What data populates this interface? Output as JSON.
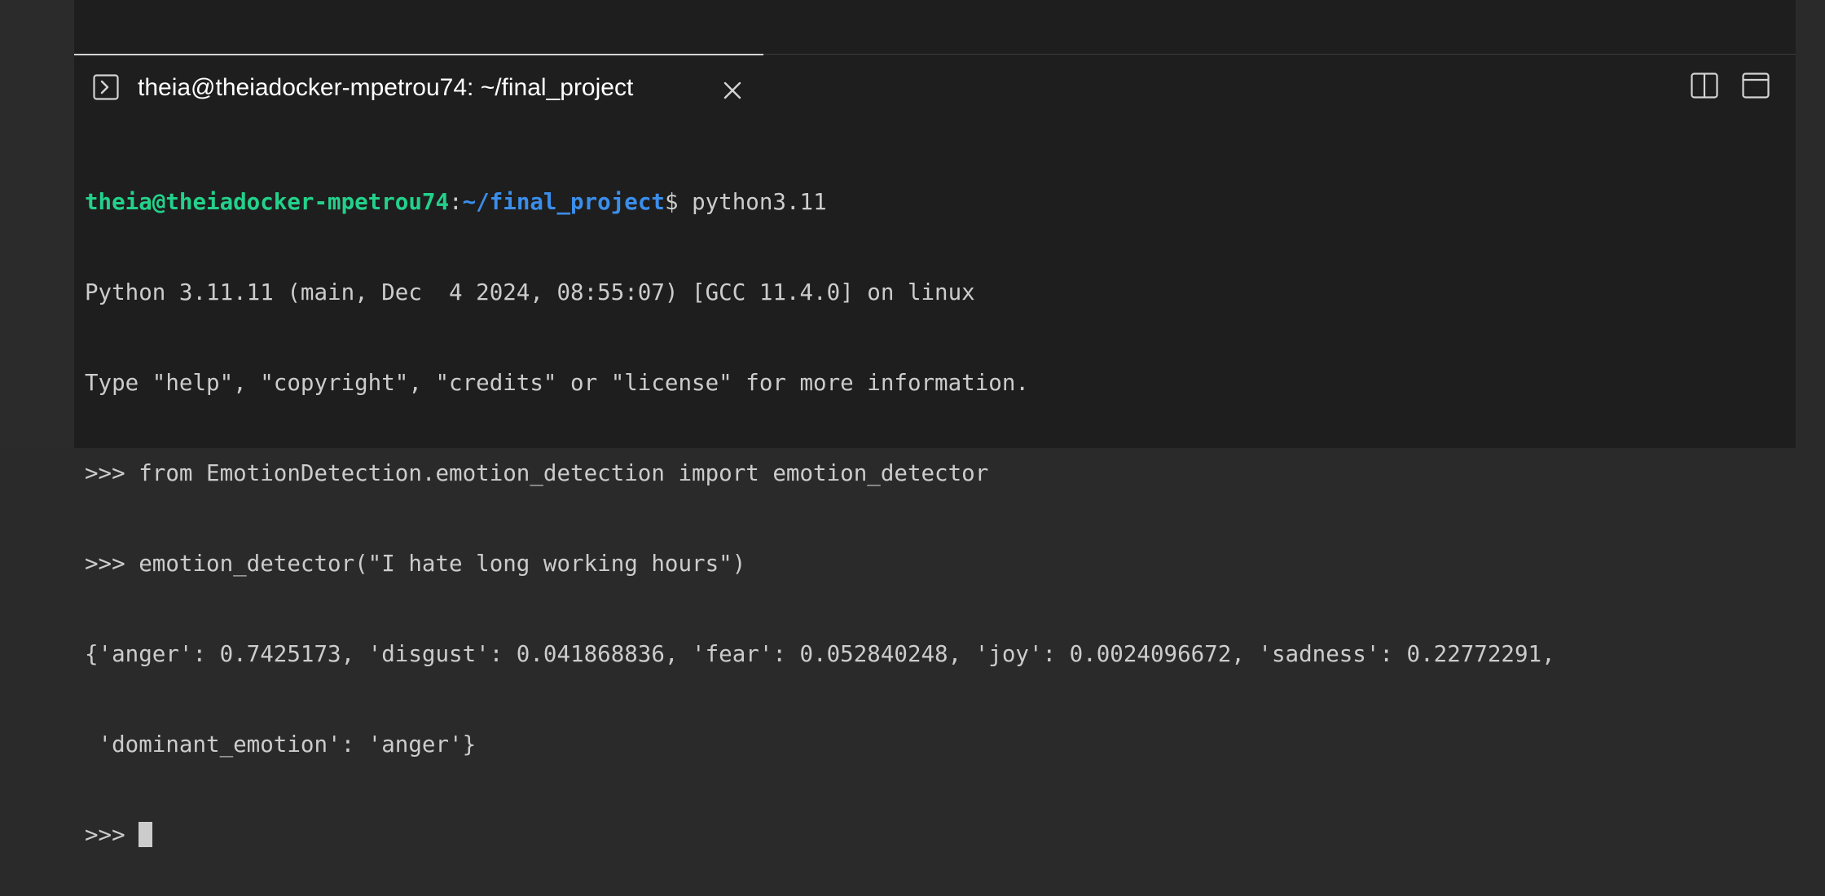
{
  "terminal_tab": {
    "title": "theia@theiadocker-mpetrou74: ~/final_project",
    "icon": "terminal-icon",
    "close_icon": "close-icon"
  },
  "toolbar": {
    "split_icon": "split-terminal-icon",
    "maximize_icon": "maximize-panel-icon"
  },
  "colors": {
    "prompt_user": "#23d18b",
    "prompt_path": "#3b8eea",
    "text": "#cccccc",
    "background": "#1e1e1e"
  },
  "terminal": {
    "prompt_user": "theia@theiadocker-mpetrou74",
    "prompt_sep": ":",
    "prompt_path": "~/final_project",
    "prompt_dollar": "$",
    "command": " python3.11",
    "lines": [
      "Python 3.11.11 (main, Dec  4 2024, 08:55:07) [GCC 11.4.0] on linux",
      "Type \"help\", \"copyright\", \"credits\" or \"license\" for more information.",
      ">>> from EmotionDetection.emotion_detection import emotion_detector",
      ">>> emotion_detector(\"I hate long working hours\")",
      "{'anger': 0.7425173, 'disgust': 0.041868836, 'fear': 0.052840248, 'joy': 0.0024096672, 'sadness': 0.22772291,",
      " 'dominant_emotion': 'anger'}"
    ],
    "final_prompt": ">>> "
  }
}
